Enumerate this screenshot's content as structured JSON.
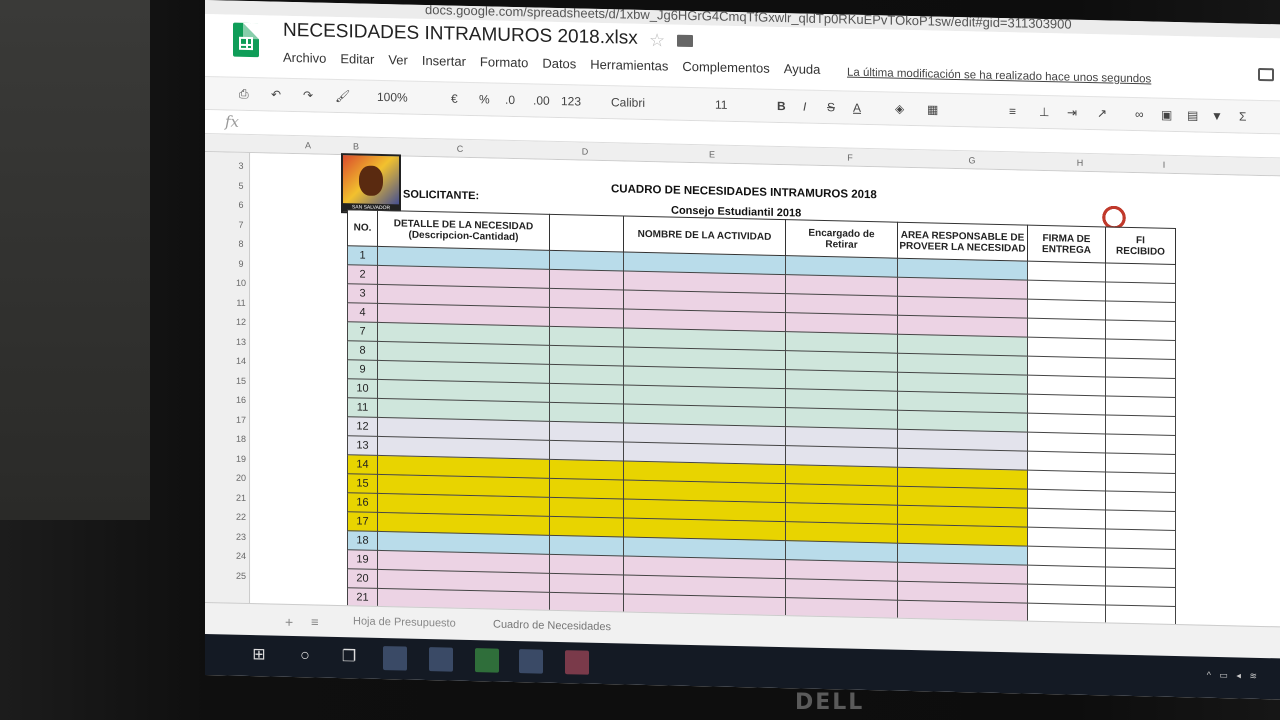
{
  "monitor": {
    "brand": "DELL"
  },
  "browser": {
    "url": "docs.google.com/spreadsheets/d/1xbw_Jg6HGrG4CmqTfGxwlr_qldTp0RKuEPvTOkoP1sw/edit#gid=311303900"
  },
  "document": {
    "title": "NECESIDADES INTRAMUROS 2018.xlsx",
    "last_modified": "La última modificación se ha realizado hace unos segundos"
  },
  "menu": [
    "Archivo",
    "Editar",
    "Ver",
    "Insertar",
    "Formato",
    "Datos",
    "Herramientas",
    "Complementos",
    "Ayuda"
  ],
  "toolbar": {
    "zoom": "100%",
    "currency": "€",
    "percent": "%",
    "dec_less": ".0",
    "dec_more": ".00",
    "more_formats": "123",
    "font": "Calibri",
    "size": "11",
    "bold": "B",
    "italic": "I",
    "strike": "S",
    "textcolor": "A"
  },
  "columns": [
    "A",
    "B",
    "C",
    "D",
    "E",
    "F",
    "G",
    "H",
    "I"
  ],
  "row_numbers": [
    "3",
    "5",
    "6",
    "7",
    "8",
    "9",
    "10",
    "11",
    "12",
    "13",
    "14",
    "15",
    "16",
    "17",
    "18",
    "19",
    "20",
    "21",
    "22",
    "23",
    "24",
    "25"
  ],
  "sheet": {
    "title": "CUADRO DE NECESIDADES INTRAMUROS 2018",
    "subtitle": "Consejo Estudiantil 2018",
    "solicitante": "SOLICITANTE:",
    "logo_text": "SAN SALVADOR"
  },
  "table": {
    "headers": [
      "NO.",
      "DETALLE DE LA NECESIDAD",
      "(Descripcion-Cantidad)",
      "NOMBRE DE LA ACTIVIDAD",
      "Encargado de",
      "Retirar",
      "AREA RESPONSABLE DE",
      "PROVEER LA NECESIDAD",
      "FIRMA DE",
      "ENTREGA",
      "FI",
      "RECIBIDO"
    ],
    "rows": [
      {
        "no": "1",
        "color": "#b9dcea"
      },
      {
        "no": "2",
        "color": "#ecd3e4"
      },
      {
        "no": "3",
        "color": "#ecd3e4"
      },
      {
        "no": "4",
        "color": "#ecd3e4"
      },
      {
        "no": "7",
        "color": "#cfe6dc"
      },
      {
        "no": "8",
        "color": "#cfe6dc"
      },
      {
        "no": "9",
        "color": "#cfe6dc"
      },
      {
        "no": "10",
        "color": "#cfe6dc"
      },
      {
        "no": "11",
        "color": "#cfe6dc"
      },
      {
        "no": "12",
        "color": "#e3e3ec"
      },
      {
        "no": "13",
        "color": "#e3e3ec"
      },
      {
        "no": "14",
        "color": "#e8d400"
      },
      {
        "no": "15",
        "color": "#e8d400"
      },
      {
        "no": "16",
        "color": "#e8d400"
      },
      {
        "no": "17",
        "color": "#e8d400"
      },
      {
        "no": "18",
        "color": "#b9dcea"
      },
      {
        "no": "19",
        "color": "#ecd3e4"
      },
      {
        "no": "20",
        "color": "#ecd3e4"
      },
      {
        "no": "21",
        "color": "#ecd3e4"
      }
    ]
  },
  "sheets": [
    "Hoja de Presupuesto",
    "Cuadro de Necesidades"
  ],
  "taskbar": {
    "tray": "^ ▭ ◂ ≋"
  }
}
